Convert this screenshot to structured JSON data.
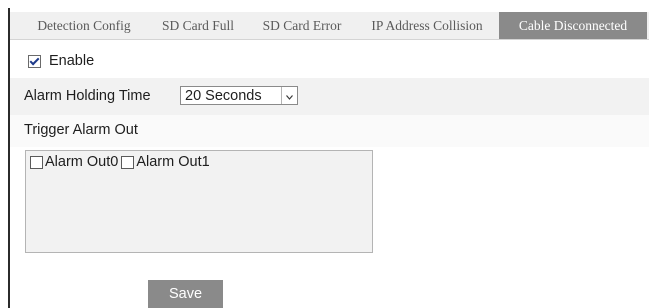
{
  "tabs": [
    {
      "label": "Detection Config",
      "active": false
    },
    {
      "label": "SD Card Full",
      "active": false
    },
    {
      "label": "SD Card Error",
      "active": false
    },
    {
      "label": "IP Address Collision",
      "active": false
    },
    {
      "label": "Cable Disconnected",
      "active": true
    }
  ],
  "enable": {
    "label": "Enable",
    "checked": true
  },
  "alarm_holding": {
    "label": "Alarm Holding Time",
    "value": "20 Seconds"
  },
  "trigger": {
    "label": "Trigger Alarm Out",
    "outputs": [
      {
        "label": "Alarm Out0",
        "checked": false
      },
      {
        "label": "Alarm Out1",
        "checked": false
      }
    ]
  },
  "save_label": "Save",
  "colors": {
    "active_tab": "#8a8a8a",
    "button": "#8a8a8a",
    "band": "#f2f2f2"
  }
}
